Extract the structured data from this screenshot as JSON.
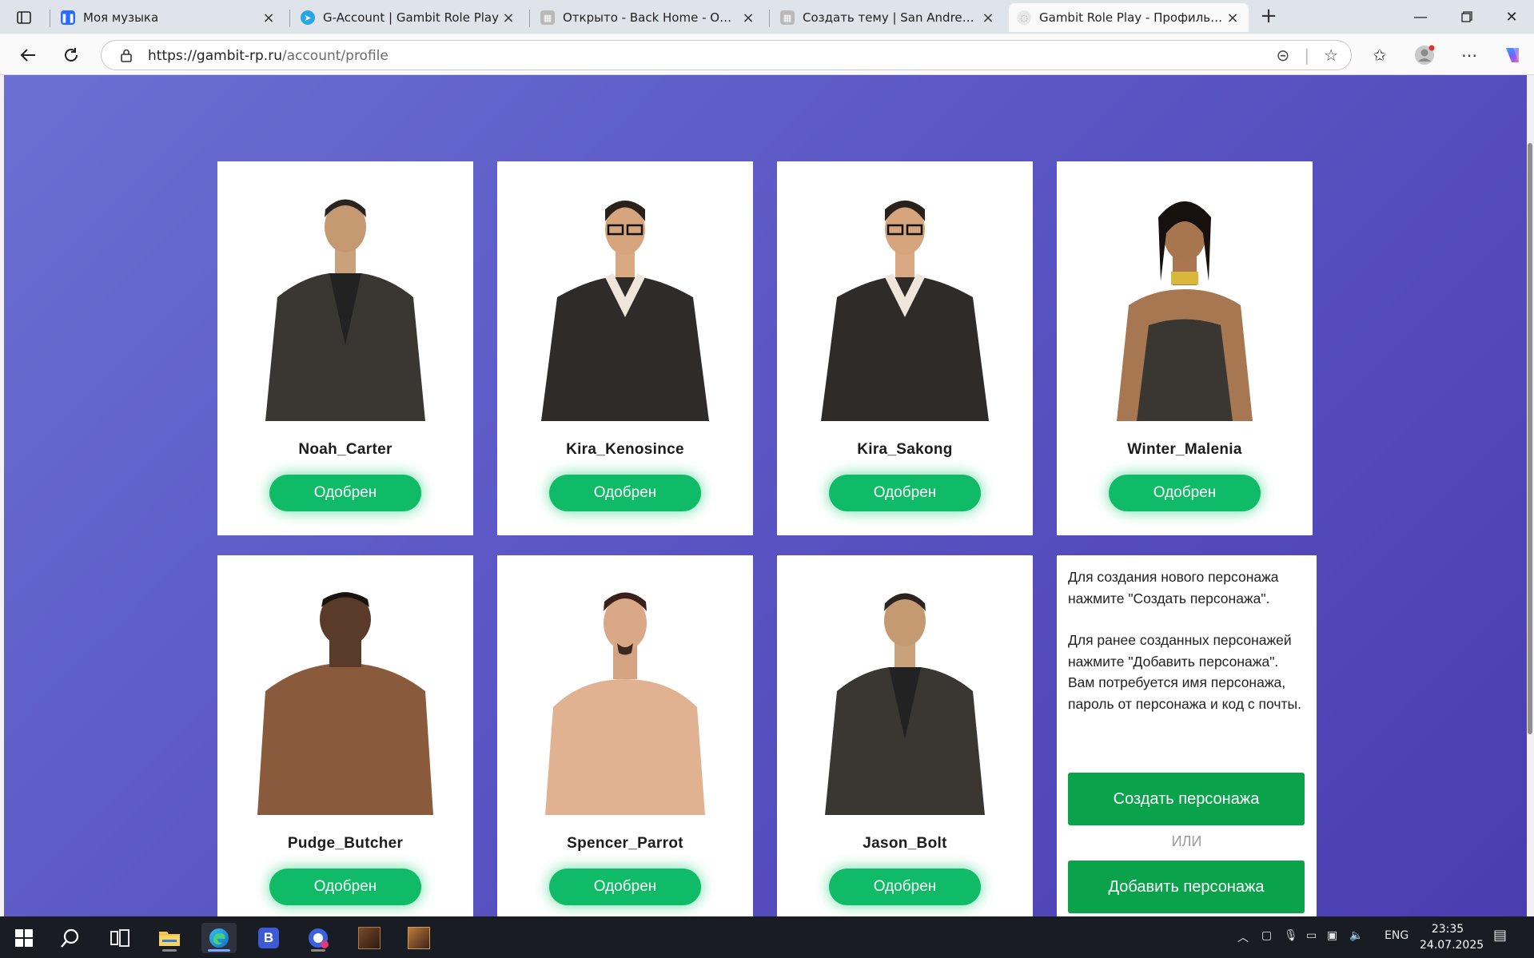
{
  "browser": {
    "tabs": [
      {
        "title": "Моя музыка",
        "fav_color": "#2a6bff",
        "fav_glyph": "❚❚"
      },
      {
        "title": "G-Account | Gambit Role Play",
        "fav_color": "#27a6e5",
        "fav_glyph": "➤"
      },
      {
        "title": "Открыто - Back Home - ООС - Пр",
        "fav_color": "#b9b9b9",
        "fav_glyph": "▦"
      },
      {
        "title": "Создать тему | San Andreas Emer",
        "fav_color": "#b9b9b9",
        "fav_glyph": "▦"
      },
      {
        "title": "Gambit Role Play - Профиль UCP",
        "fav_color": "#dddddd",
        "fav_glyph": "◌"
      }
    ],
    "url_host": "https://gambit-rp.ru",
    "url_path": "/account/profile"
  },
  "characters": [
    {
      "name": "Noah_Carter",
      "status": "Одобрен"
    },
    {
      "name": "Kira_Kenosince",
      "status": "Одобрен"
    },
    {
      "name": "Kira_Sakong",
      "status": "Одобрен"
    },
    {
      "name": "Winter_Malenia",
      "status": "Одобрен"
    },
    {
      "name": "Pudge_Butcher",
      "status": "Одобрен"
    },
    {
      "name": "Spencer_Parrot",
      "status": "Одобрен"
    },
    {
      "name": "Jason_Bolt",
      "status": "Одобрен"
    }
  ],
  "info": {
    "text1": "Для создания нового персонажа нажмите \"Создать персонажа\".",
    "text2": "Для ранее созданных персонажей нажмите \"Добавить персонажа\". Вам потребуется имя персонажа, пароль от персонажа и код с почты.",
    "create_label": "Создать персонажа",
    "or_label": "ИЛИ",
    "add_label": "Добавить персонажа"
  },
  "taskbar": {
    "lang": "ENG",
    "time": "23:35",
    "date": "24.07.2025"
  }
}
